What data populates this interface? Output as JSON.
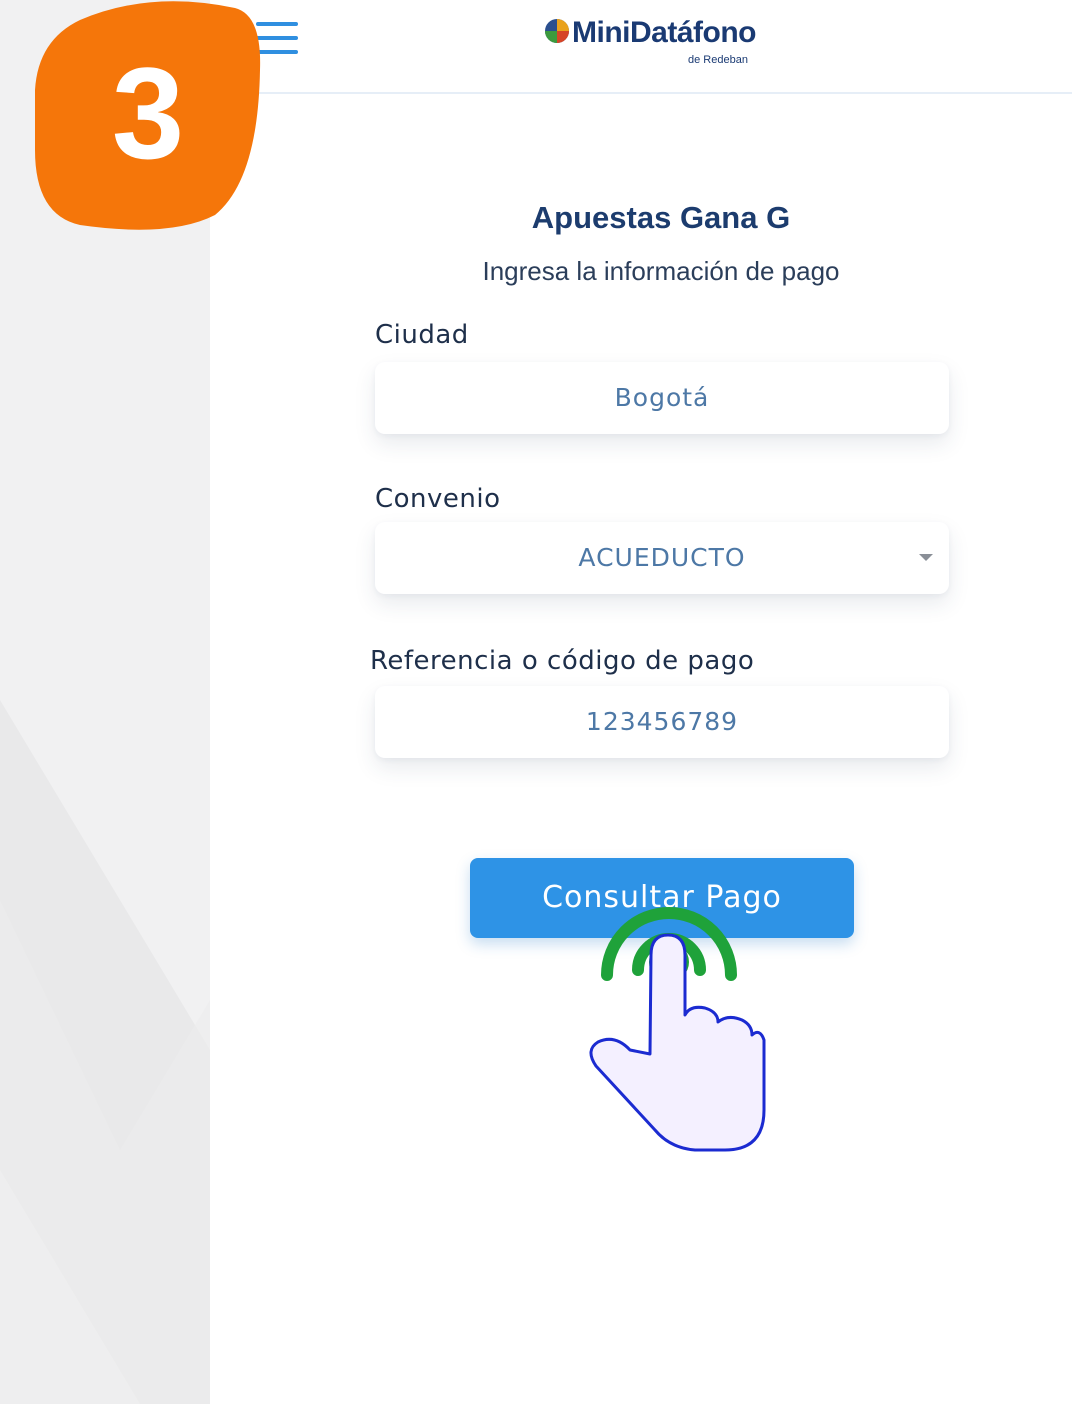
{
  "header": {
    "menu_icon": "hamburger-menu-icon",
    "logo_text": "MiniDatáfono",
    "logo_subtext": "de Redeban"
  },
  "page": {
    "title": "Apuestas Gana G",
    "subtitle": "Ingresa la información de pago"
  },
  "form": {
    "city_label": "Ciudad",
    "city_value": "Bogotá",
    "agreement_label": "Convenio",
    "agreement_value": "ACUEDUCTO",
    "reference_label": "Referencia o código de pago",
    "reference_value": "123456789"
  },
  "actions": {
    "submit_label": "Consultar Pago"
  },
  "step": {
    "number": "3",
    "color": "#f5760a"
  },
  "colors": {
    "primary": "#2e93e6",
    "title": "#1c3c6e",
    "tap_indicator": "#1fa23a",
    "hand_fill": "#f4f0ff",
    "hand_stroke": "#1b2bd1"
  }
}
